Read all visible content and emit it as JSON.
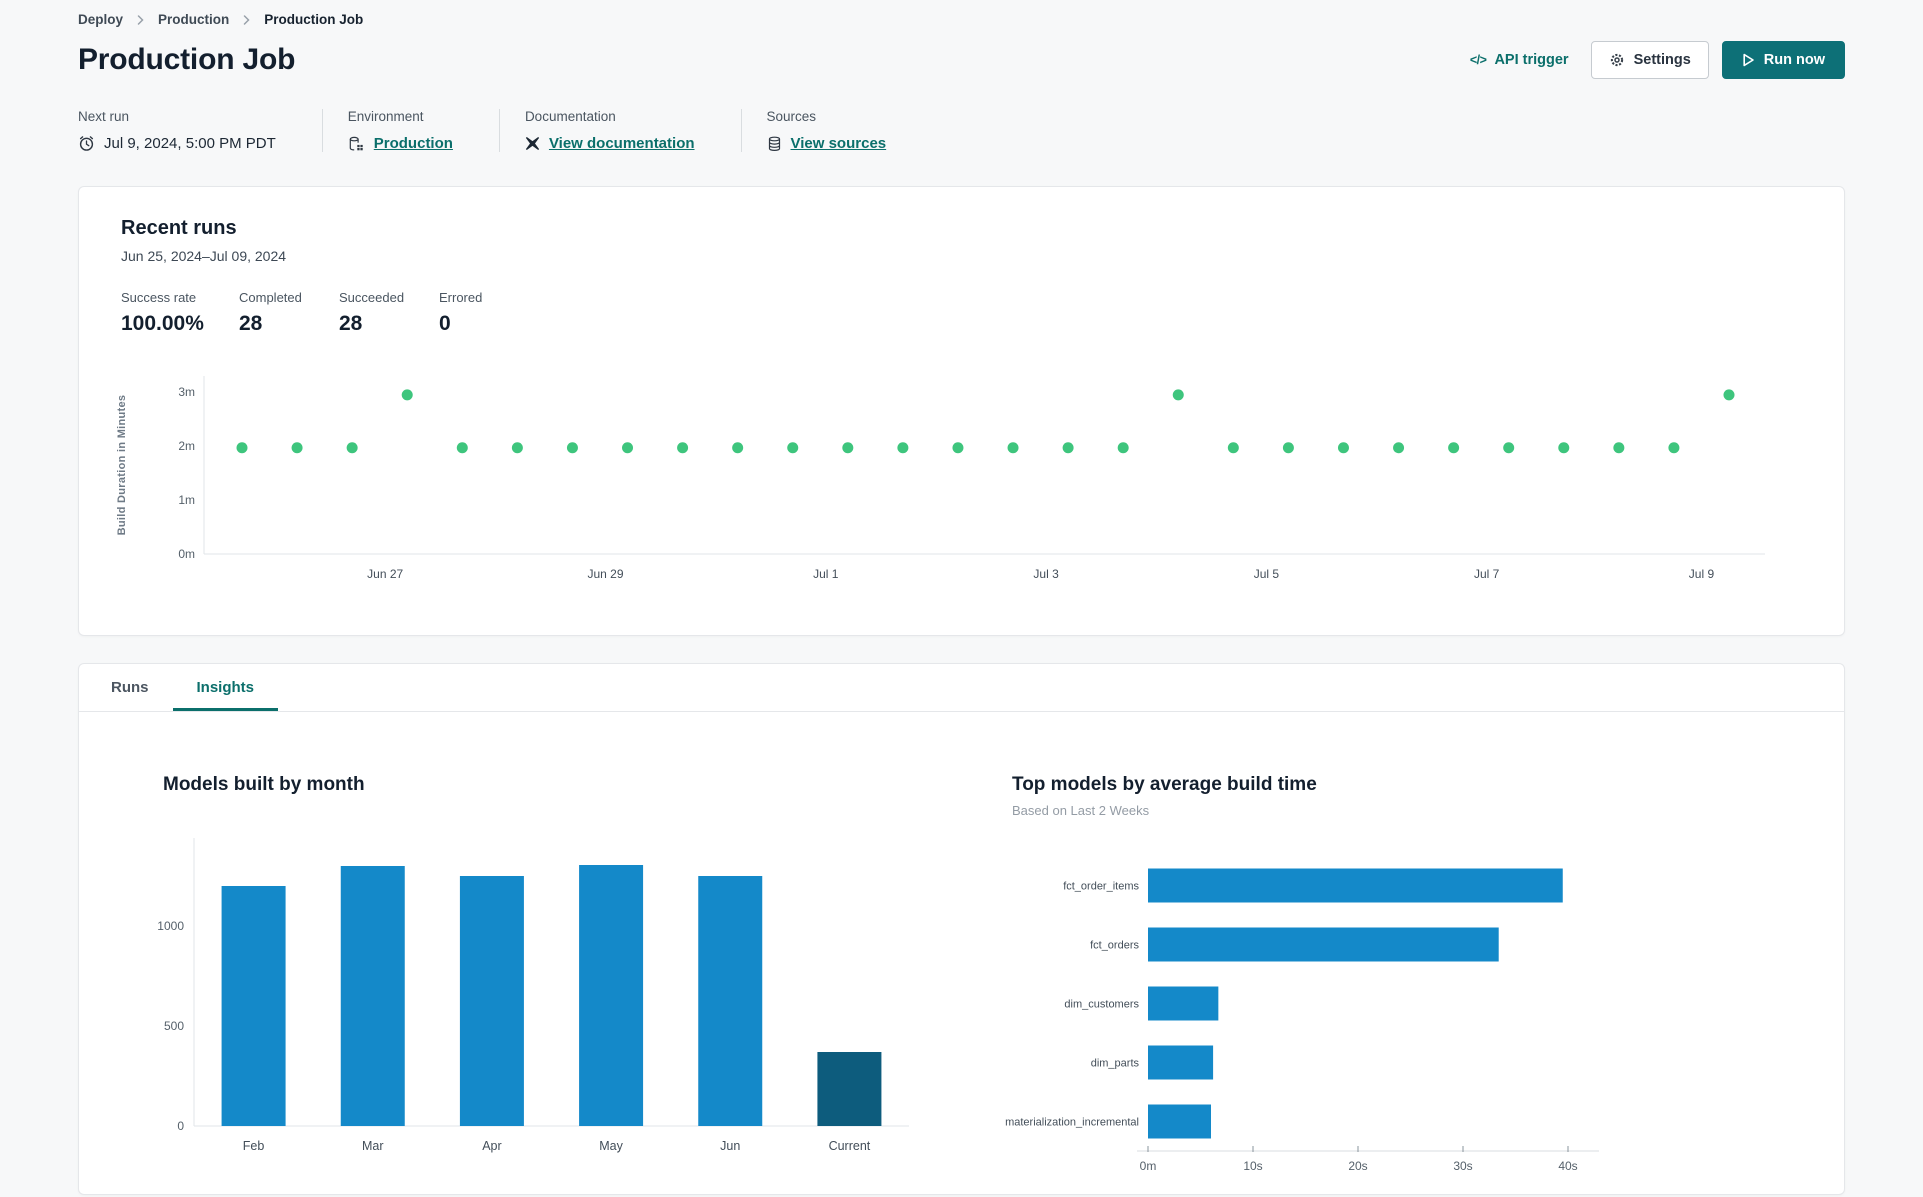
{
  "colors": {
    "accent_teal": "#0b6f6b",
    "button_teal": "#0d7077",
    "bar_blue": "#1489c9",
    "bar_dark": "#0d5c7d",
    "dot_green": "#3ec57d"
  },
  "breadcrumb": {
    "items": [
      "Deploy",
      "Production",
      "Production Job"
    ]
  },
  "header": {
    "title": "Production Job",
    "api_trigger_label": "API trigger",
    "api_trigger_glyph": "</>",
    "settings_label": "Settings",
    "run_now_label": "Run now"
  },
  "info": {
    "next_run": {
      "label": "Next run",
      "value": "Jul 9, 2024, 5:00 PM PDT"
    },
    "environment": {
      "label": "Environment",
      "value": "Production"
    },
    "documentation": {
      "label": "Documentation",
      "value": "View documentation"
    },
    "sources": {
      "label": "Sources",
      "value": "View sources"
    }
  },
  "recent_runs": {
    "title": "Recent runs",
    "date_range": "Jun 25, 2024–Jul 09, 2024",
    "stats": [
      {
        "label": "Success rate",
        "value": "100.00%"
      },
      {
        "label": "Completed",
        "value": "28"
      },
      {
        "label": "Succeeded",
        "value": "28"
      },
      {
        "label": "Errored",
        "value": "0"
      }
    ]
  },
  "tabs": [
    {
      "label": "Runs",
      "active": false
    },
    {
      "label": "Insights",
      "active": true
    }
  ],
  "insights": {
    "left_title": "Models built by month",
    "right_title": "Top models by average build time",
    "right_subtitle": "Based on Last 2 Weeks"
  },
  "chart_data": [
    {
      "id": "recent-runs-scatter",
      "type": "scatter",
      "title": "Recent runs build durations",
      "ylabel": "Build Duration in Minutes",
      "ylim": [
        0,
        3.3
      ],
      "y_ticks": [
        {
          "v": 0,
          "label": "0m"
        },
        {
          "v": 1,
          "label": "1m"
        },
        {
          "v": 2,
          "label": "2m"
        },
        {
          "v": 3,
          "label": "3m"
        }
      ],
      "x_tick_labels": [
        "Jun 27",
        "Jun 29",
        "Jul 1",
        "Jul 3",
        "Jul 5",
        "Jul 7",
        "Jul 9"
      ],
      "x_tick_positions": [
        2.6,
        6.6,
        10.6,
        14.6,
        18.6,
        22.6,
        26.5
      ],
      "points_minutes": [
        1.97,
        1.97,
        1.97,
        2.95,
        1.97,
        1.97,
        1.97,
        1.97,
        1.97,
        1.97,
        1.97,
        1.97,
        1.97,
        1.97,
        1.97,
        1.97,
        1.97,
        2.95,
        1.97,
        1.97,
        1.97,
        1.97,
        1.97,
        1.97,
        1.97,
        1.97,
        1.97,
        2.95
      ],
      "point_color": "#3ec57d",
      "grid": false,
      "legend": "none"
    },
    {
      "id": "models-by-month",
      "type": "bar",
      "title": "Models built by month",
      "categories": [
        "Feb",
        "Mar",
        "Apr",
        "May",
        "Jun",
        "Current"
      ],
      "values": [
        1200,
        1300,
        1250,
        1305,
        1250,
        370
      ],
      "y_ticks": [
        0,
        500,
        1000
      ],
      "ylim": [
        0,
        1400
      ],
      "bar_color": "#1489c9",
      "highlight": {
        "index": 5,
        "color": "#0d5c7d"
      },
      "grid": false,
      "legend": "none"
    },
    {
      "id": "top-models",
      "type": "hbar",
      "title": "Top models by average build time",
      "subtitle": "Based on Last 2 Weeks",
      "categories": [
        "fct_order_items",
        "fct_orders",
        "dim_customers",
        "dim_parts",
        "materialization_incremental"
      ],
      "values_seconds": [
        39.5,
        33.4,
        6.7,
        6.2,
        6.0
      ],
      "x_ticks": [
        {
          "v": 0,
          "label": "0m"
        },
        {
          "v": 10,
          "label": "10s"
        },
        {
          "v": 20,
          "label": "20s"
        },
        {
          "v": 30,
          "label": "30s"
        },
        {
          "v": 40,
          "label": "40s"
        }
      ],
      "xlim": [
        0,
        43
      ],
      "bar_color": "#1489c9",
      "grid": false,
      "legend": "none"
    }
  ]
}
